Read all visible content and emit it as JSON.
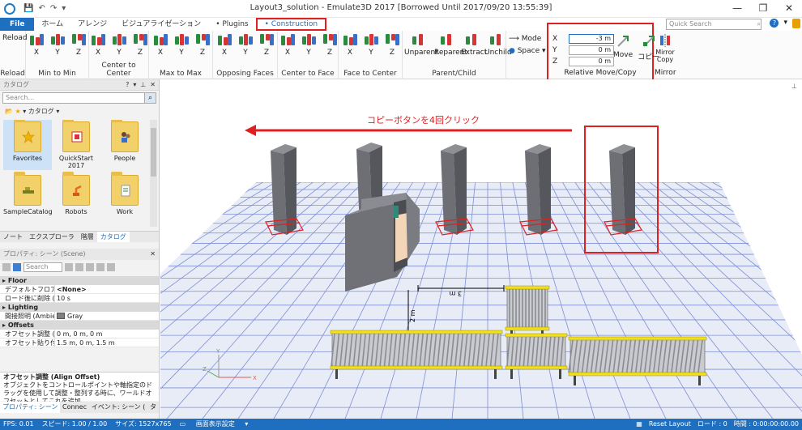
{
  "window": {
    "title": "Layout3_solution - Emulate3D 2017 [Borrowed Until 2017/09/20 13:55:39]",
    "controls": [
      "—",
      "❐",
      "✕"
    ]
  },
  "tabs": [
    {
      "label": "File"
    },
    {
      "label": "ホーム"
    },
    {
      "label": "アレンジ"
    },
    {
      "label": "ビジュアライゼーション"
    },
    {
      "label": "• Plugins"
    },
    {
      "label": "• Construction"
    }
  ],
  "quick_search": {
    "placeholder": "Quick Search"
  },
  "ribbon": {
    "reload": {
      "button": "Reload",
      "label": "Reload"
    },
    "groups": [
      {
        "label": "Min to Min",
        "buttons": [
          "X",
          "Y",
          "Z"
        ]
      },
      {
        "label": "Center to Center",
        "buttons": [
          "X",
          "Y",
          "Z"
        ]
      },
      {
        "label": "Max to Max",
        "buttons": [
          "X",
          "Y",
          "Z"
        ]
      },
      {
        "label": "Opposing Faces",
        "buttons": [
          "X",
          "Y",
          "Z"
        ]
      },
      {
        "label": "Center to Face",
        "buttons": [
          "X",
          "Y",
          "Z"
        ]
      },
      {
        "label": "Face to Center",
        "buttons": [
          "X",
          "Y",
          "Z"
        ]
      }
    ],
    "parent_child": {
      "label": "Parent/Child",
      "buttons": [
        "Unparent",
        "Reparent",
        "Extract",
        "Unchild"
      ]
    },
    "mode": {
      "mode_label": "Mode",
      "space_label": "Space"
    },
    "relative": {
      "label": "Relative Move/Copy",
      "fields": [
        {
          "axis": "X",
          "value": "-3 m"
        },
        {
          "axis": "Y",
          "value": "0 m"
        },
        {
          "axis": "Z",
          "value": "0 m"
        }
      ],
      "move": "Move",
      "copy": "コピー"
    },
    "mirror": {
      "button_line1": "Mirror",
      "button_line2": "Copy",
      "label": "Mirror"
    }
  },
  "catalog": {
    "title": "カタログ",
    "search_placeholder": "Search...",
    "crumb": "カタログ",
    "items": [
      {
        "label": "Favorites"
      },
      {
        "label": "QuickStart 2017"
      },
      {
        "label": "People"
      },
      {
        "label": "SampleCatalog"
      },
      {
        "label": "Robots"
      },
      {
        "label": "Work"
      }
    ],
    "tabs": [
      "ノート",
      "エクスプローラ",
      "階層",
      "カタログ"
    ]
  },
  "properties": {
    "title": "プロパティ: シーン (Scene)",
    "search_placeholder": "Search",
    "categories": [
      {
        "name": "Floor",
        "rows": [
          {
            "key": "デフォルトフロア (Default",
            "value": "<None>"
          },
          {
            "key": "ロード後に削除 (Delete",
            "value": "10 s"
          }
        ]
      },
      {
        "name": "Lighting",
        "rows": [
          {
            "key": "間接照明 (Ambient Lig",
            "value": "Gray"
          }
        ]
      },
      {
        "name": "Offsets",
        "rows": [
          {
            "key": "オフセット調整 (Align O",
            "value": "0 m, 0 m, 0 m"
          },
          {
            "key": "オフセット貼り付け (Paste",
            "value": "1.5 m, 0 m, 1.5 m"
          }
        ]
      }
    ],
    "desc_title": "オフセット調整 (Align Offset)",
    "desc_text": "オブジェクトをコントロールポイントや軸指定のドラッグを使用して調整・整列する時に、ワールドオフセットとしてこれを追加...",
    "bottom_tabs": [
      "プロパティ: シーン",
      "Connec",
      "イベント: シーン (",
      "タ"
    ]
  },
  "viewport": {
    "annotation": "コピーボタンを4回クリック",
    "dim_horizontal": "3 m",
    "dim_vertical": "2 m",
    "axes": {
      "x": "X",
      "y": "Y",
      "z": "Z"
    }
  },
  "status": {
    "fps": "FPS: 0.01",
    "speed": "スピード: 1.00 / 1.00",
    "size": "サイズ: 1527x765",
    "display": "画面表示設定",
    "reset": "Reset Layout",
    "load": "ロード : 0",
    "time": "時間 : 0:00:00:00.00"
  },
  "colors": {
    "accent": "#1e6fbf",
    "highlight": "#e02020"
  }
}
